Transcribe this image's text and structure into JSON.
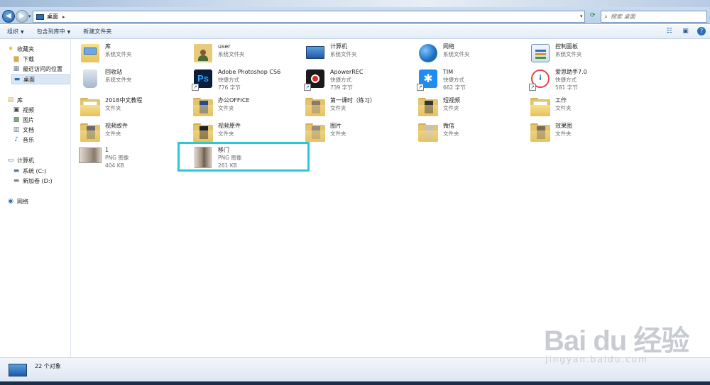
{
  "window": {
    "address_crumb": "桌面",
    "search_placeholder": "搜索 桌面"
  },
  "toolbar": {
    "organize": "组织",
    "include_in_library": "包含到库中",
    "new_folder": "新建文件夹"
  },
  "nav": {
    "favorites": "收藏夹",
    "downloads": "下载",
    "recent": "最近访问的位置",
    "desktop": "桌面",
    "libraries": "库",
    "videos": "视频",
    "pictures": "图片",
    "documents": "文档",
    "music": "音乐",
    "computer": "计算机",
    "drive_c": "系统 (C:)",
    "drive_d": "新加卷 (D:)",
    "network": "网络"
  },
  "items": [
    {
      "name": "库",
      "sub1": "系统文件夹",
      "sub2": "",
      "icon": "library-icon"
    },
    {
      "name": "user",
      "sub1": "系统文件夹",
      "sub2": "",
      "icon": "user-folder-icon"
    },
    {
      "name": "计算机",
      "sub1": "系统文件夹",
      "sub2": "",
      "icon": "computer-icon"
    },
    {
      "name": "网络",
      "sub1": "系统文件夹",
      "sub2": "",
      "icon": "network-icon"
    },
    {
      "name": "控制面板",
      "sub1": "系统文件夹",
      "sub2": "",
      "icon": "control-panel-icon"
    },
    {
      "name": "回收站",
      "sub1": "系统文件夹",
      "sub2": "",
      "icon": "recycle-bin-icon"
    },
    {
      "name": "Adobe Photoshop CS6",
      "sub1": "快捷方式",
      "sub2": "776 字节",
      "icon": "photoshop-icon"
    },
    {
      "name": "ApowerREC",
      "sub1": "快捷方式",
      "sub2": "739 字节",
      "icon": "apowerrec-icon"
    },
    {
      "name": "TIM",
      "sub1": "快捷方式",
      "sub2": "662 字节",
      "icon": "tim-icon"
    },
    {
      "name": "爱思助手7.0",
      "sub1": "快捷方式",
      "sub2": "581 字节",
      "icon": "aisi-icon"
    },
    {
      "name": "2018中文教程",
      "sub1": "文件夹",
      "sub2": "",
      "icon": "folder-icon"
    },
    {
      "name": "办公OFFICE",
      "sub1": "文件夹",
      "sub2": "",
      "icon": "folder-icon"
    },
    {
      "name": "第一课时（练习）",
      "sub1": "文件夹",
      "sub2": "",
      "icon": "folder-icon"
    },
    {
      "name": "短视频",
      "sub1": "文件夹",
      "sub2": "",
      "icon": "folder-icon"
    },
    {
      "name": "工作",
      "sub1": "文件夹",
      "sub2": "",
      "icon": "folder-icon"
    },
    {
      "name": "视频故件",
      "sub1": "文件夹",
      "sub2": "",
      "icon": "folder-icon"
    },
    {
      "name": "视频原件",
      "sub1": "文件夹",
      "sub2": "",
      "icon": "folder-icon"
    },
    {
      "name": "图片",
      "sub1": "文件夹",
      "sub2": "",
      "icon": "folder-icon"
    },
    {
      "name": "微信",
      "sub1": "文件夹",
      "sub2": "",
      "icon": "folder-icon"
    },
    {
      "name": "效果图",
      "sub1": "文件夹",
      "sub2": "",
      "icon": "folder-icon"
    },
    {
      "name": "1",
      "sub1": "PNG 图像",
      "sub2": "404 KB",
      "icon": "image-thumbnail-icon"
    },
    {
      "name": "移门",
      "sub1": "PNG 图像",
      "sub2": "261 KB",
      "icon": "image-thumbnail-icon"
    }
  ],
  "status": {
    "count": "22 个对象"
  },
  "watermark": {
    "main": "Bai du 经验",
    "sub": "jingyan.baidu.com"
  },
  "colors": {
    "highlight": "#29c9d4",
    "selection": "#dbe7f5"
  }
}
